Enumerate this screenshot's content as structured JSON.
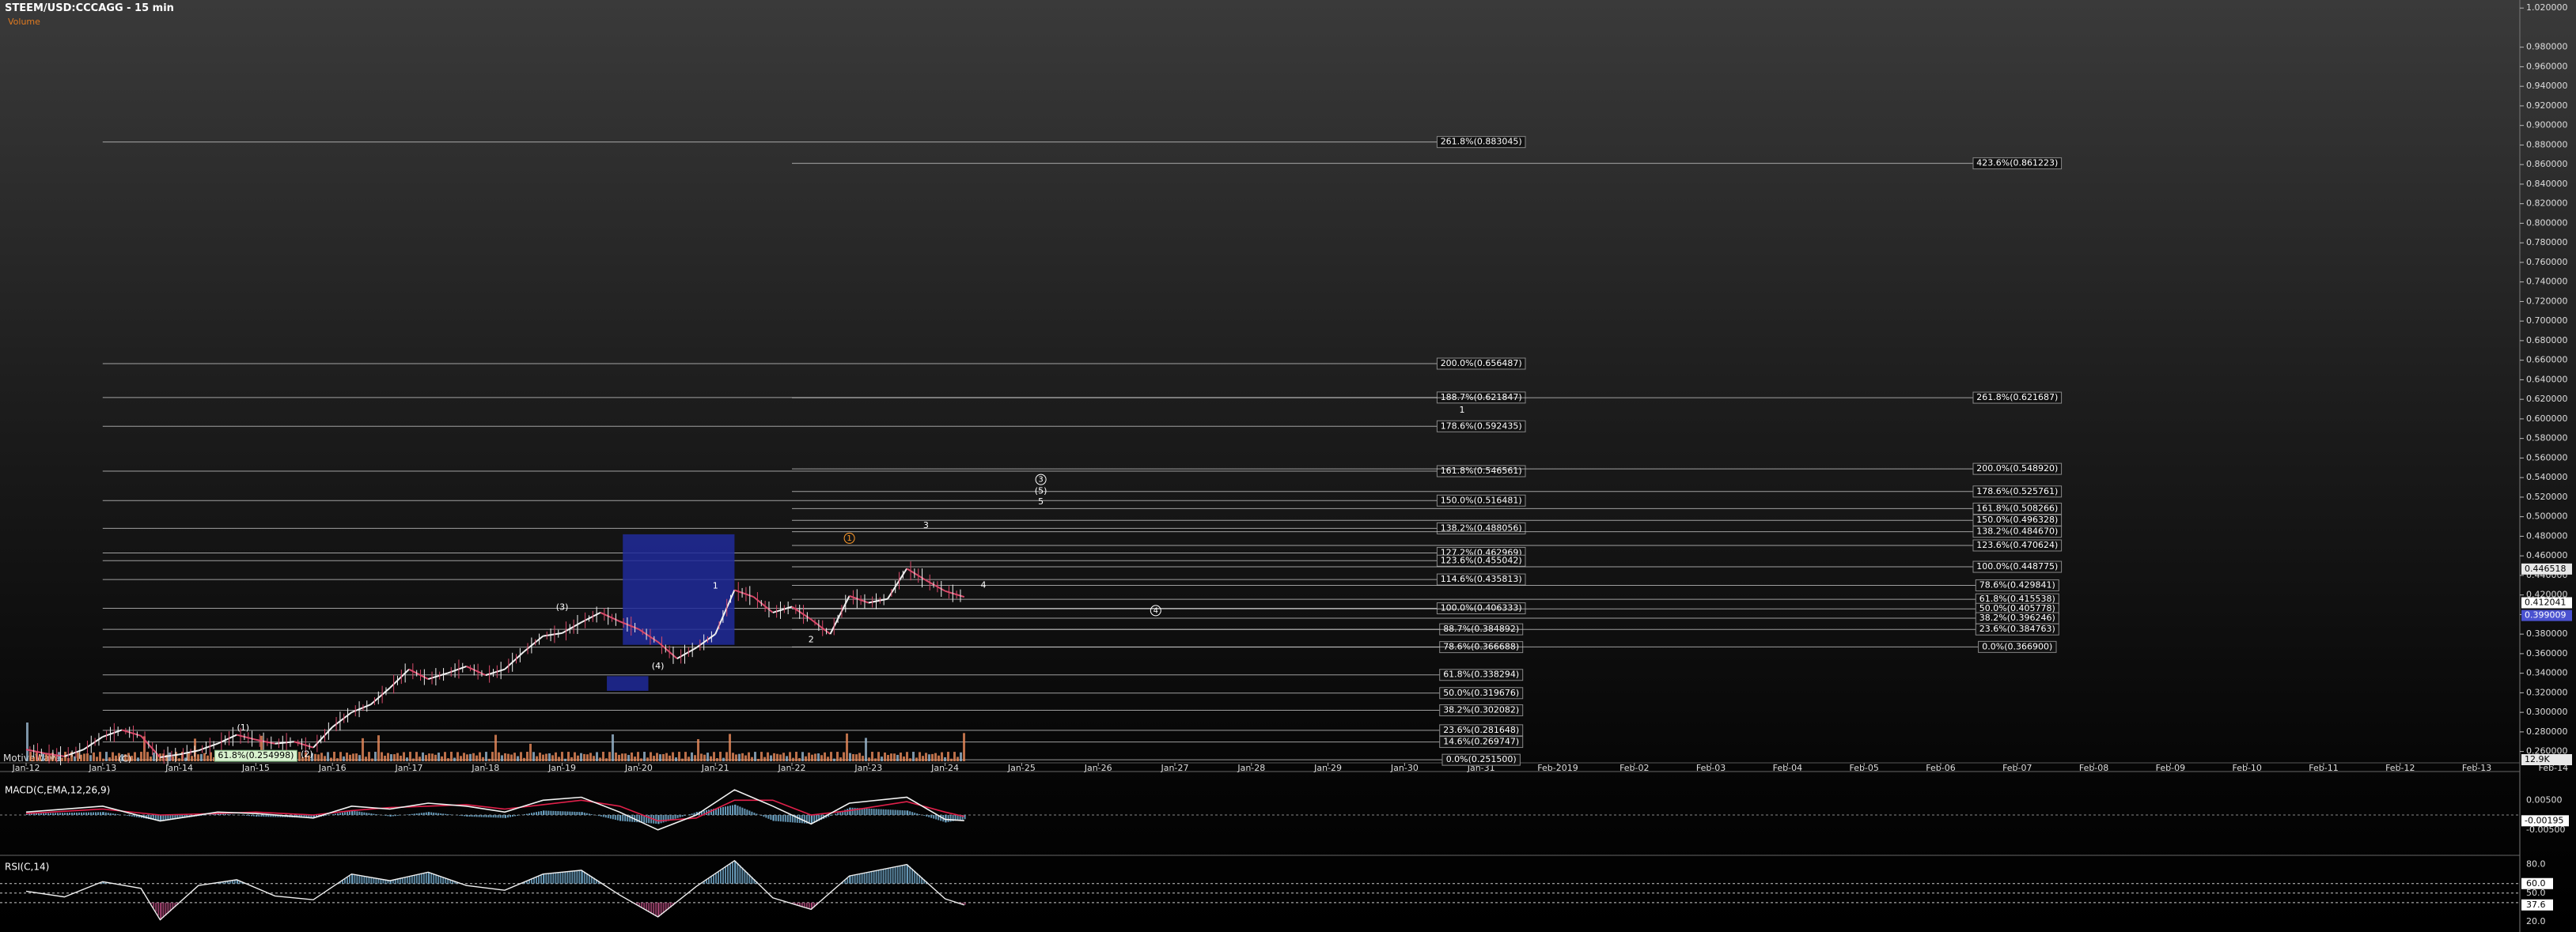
{
  "header": {
    "title": "STEEM/USD:CCCAGG - 15 min",
    "volume_label": "Volume",
    "brand": "MotiveWave"
  },
  "colors": {
    "up": "#f0f0f0",
    "down": "#d84a6a",
    "box": "#202a9a",
    "volume": "#e88a5a",
    "macd": "#f2f2f2",
    "signal": "#e0204a",
    "hist": "#6fa6c8",
    "rsi": "#f0f0f0"
  },
  "chart_data": {
    "type": "line",
    "x_ticks": [
      "Jan-12",
      "Jan-13",
      "Jan-14",
      "Jan-15",
      "Jan-16",
      "Jan-17",
      "Jan-18",
      "Jan-19",
      "Jan-20",
      "Jan-21",
      "Jan-22",
      "Jan-23",
      "Jan-24",
      "Jan-25",
      "Jan-26",
      "Jan-27",
      "Jan-28",
      "Jan-29",
      "Jan-30",
      "Jan-31",
      "Feb-2019",
      "Feb-02",
      "Feb-03",
      "Feb-04",
      "Feb-05",
      "Feb-06",
      "Feb-07",
      "Feb-08",
      "Feb-09",
      "Feb-10",
      "Feb-11",
      "Feb-12",
      "Feb-13",
      "Feb-14"
    ],
    "y_ticks": [
      "1.020000",
      "0.980000",
      "0.960000",
      "0.940000",
      "0.920000",
      "0.900000",
      "0.880000",
      "0.860000",
      "0.840000",
      "0.820000",
      "0.800000",
      "0.780000",
      "0.760000",
      "0.740000",
      "0.720000",
      "0.700000",
      "0.680000",
      "0.660000",
      "0.640000",
      "0.620000",
      "0.600000",
      "0.580000",
      "0.560000",
      "0.540000",
      "0.520000",
      "0.500000",
      "0.480000",
      "0.460000",
      "0.440000",
      "0.420000",
      "0.400000",
      "0.380000",
      "0.360000",
      "0.340000",
      "0.320000",
      "0.300000",
      "0.280000",
      "0.260000"
    ],
    "ylim": [
      0.25,
      1.025
    ],
    "price_labels": {
      "top": "0.446518",
      "mid": "0.412041",
      "bot": "0.399009",
      "volume": "12.9K"
    },
    "price_path": [
      [
        "Jan-12 00:00",
        0.262
      ],
      [
        "Jan-12 06:00",
        0.258
      ],
      [
        "Jan-12 12:00",
        0.255
      ],
      [
        "Jan-12 18:00",
        0.262
      ],
      [
        "Jan-13 00:00",
        0.275
      ],
      [
        "Jan-13 06:00",
        0.282
      ],
      [
        "Jan-13 12:00",
        0.276
      ],
      [
        "Jan-13 18:00",
        0.254
      ],
      [
        "Jan-14 00:00",
        0.257
      ],
      [
        "Jan-14 06:00",
        0.261
      ],
      [
        "Jan-14 12:00",
        0.268
      ],
      [
        "Jan-14 18:00",
        0.277
      ],
      [
        "Jan-15 00:00",
        0.272
      ],
      [
        "Jan-15 06:00",
        0.268
      ],
      [
        "Jan-15 12:00",
        0.27
      ],
      [
        "Jan-15 18:00",
        0.264
      ],
      [
        "Jan-16 00:00",
        0.285
      ],
      [
        "Jan-16 06:00",
        0.3
      ],
      [
        "Jan-16 12:00",
        0.308
      ],
      [
        "Jan-16 18:00",
        0.325
      ],
      [
        "Jan-17 00:00",
        0.344
      ],
      [
        "Jan-17 06:00",
        0.334
      ],
      [
        "Jan-17 12:00",
        0.34
      ],
      [
        "Jan-17 18:00",
        0.347
      ],
      [
        "Jan-18 00:00",
        0.338
      ],
      [
        "Jan-18 06:00",
        0.344
      ],
      [
        "Jan-18 12:00",
        0.362
      ],
      [
        "Jan-18 18:00",
        0.378
      ],
      [
        "Jan-19 00:00",
        0.381
      ],
      [
        "Jan-19 06:00",
        0.392
      ],
      [
        "Jan-19 12:00",
        0.402
      ],
      [
        "Jan-19 18:00",
        0.393
      ],
      [
        "Jan-20 00:00",
        0.385
      ],
      [
        "Jan-20 06:00",
        0.372
      ],
      [
        "Jan-20 12:00",
        0.355
      ],
      [
        "Jan-20 18:00",
        0.366
      ],
      [
        "Jan-21 00:00",
        0.38
      ],
      [
        "Jan-21 06:00",
        0.425
      ],
      [
        "Jan-21 12:00",
        0.418
      ],
      [
        "Jan-21 18:00",
        0.402
      ],
      [
        "Jan-22 00:00",
        0.408
      ],
      [
        "Jan-22 06:00",
        0.395
      ],
      [
        "Jan-22 12:00",
        0.38
      ],
      [
        "Jan-22 18:00",
        0.419
      ],
      [
        "Jan-23 00:00",
        0.412
      ],
      [
        "Jan-23 06:00",
        0.416
      ],
      [
        "Jan-23 12:00",
        0.447
      ],
      [
        "Jan-23 18:00",
        0.435
      ],
      [
        "Jan-24 00:00",
        0.424
      ],
      [
        "Jan-24 06:00",
        0.418
      ]
    ],
    "fib_levels": [
      {
        "label": "261.8%(0.883045)",
        "value": 0.883045,
        "from": "Jan-13 00:00",
        "to": "Jan-31 00:00"
      },
      {
        "label": "200.0%(0.656487)",
        "value": 0.656487,
        "from": "Jan-13 00:00",
        "to": "Jan-31 00:00"
      },
      {
        "label": "188.7%(0.621847)",
        "value": 0.621847,
        "from": "Jan-13 00:00",
        "to": "Jan-31 00:00"
      },
      {
        "label": "178.6%(0.592435)",
        "value": 0.592435,
        "from": "Jan-13 00:00",
        "to": "Jan-31 00:00"
      },
      {
        "label": "161.8%(0.546561)",
        "value": 0.546561,
        "from": "Jan-13 00:00",
        "to": "Jan-31 00:00"
      },
      {
        "label": "150.0%(0.516481)",
        "value": 0.516481,
        "from": "Jan-13 00:00",
        "to": "Jan-31 00:00"
      },
      {
        "label": "138.2%(0.488056)",
        "value": 0.488056,
        "from": "Jan-13 00:00",
        "to": "Jan-31 00:00"
      },
      {
        "label": "127.2%(0.462969)",
        "value": 0.462969,
        "from": "Jan-13 00:00",
        "to": "Jan-31 00:00"
      },
      {
        "label": "123.6%(0.455042)",
        "value": 0.455042,
        "from": "Jan-13 00:00",
        "to": "Jan-31 00:00"
      },
      {
        "label": "114.6%(0.435813)",
        "value": 0.435813,
        "from": "Jan-13 00:00",
        "to": "Jan-31 00:00"
      },
      {
        "label": "100.0%(0.406333)",
        "value": 0.406333,
        "from": "Jan-13 00:00",
        "to": "Jan-31 00:00"
      },
      {
        "label": "88.7%(0.384892)",
        "value": 0.384892,
        "from": "Jan-13 00:00",
        "to": "Jan-31 00:00"
      },
      {
        "label": "78.6%(0.366688)",
        "value": 0.366688,
        "from": "Jan-13 00:00",
        "to": "Jan-31 00:00"
      },
      {
        "label": "61.8%(0.338294)",
        "value": 0.338294,
        "from": "Jan-13 00:00",
        "to": "Jan-31 00:00"
      },
      {
        "label": "50.0%(0.319676)",
        "value": 0.319676,
        "from": "Jan-13 00:00",
        "to": "Jan-31 00:00"
      },
      {
        "label": "38.2%(0.302082)",
        "value": 0.302082,
        "from": "Jan-13 00:00",
        "to": "Jan-31 00:00"
      },
      {
        "label": "23.6%(0.281648)",
        "value": 0.281648,
        "from": "Jan-13 00:00",
        "to": "Jan-31 00:00"
      },
      {
        "label": "14.6%(0.269747)",
        "value": 0.269747,
        "from": "Jan-13 00:00",
        "to": "Jan-31 00:00"
      },
      {
        "label": "0.0%(0.251500)",
        "value": 0.2515,
        "from": "Jan-13 00:00",
        "to": "Jan-31 00:00"
      },
      {
        "label": "423.6%(0.861223)",
        "value": 0.861223,
        "from": "Jan-22 00:00",
        "to": "Feb-07 00:00"
      },
      {
        "label": "261.8%(0.621687)",
        "value": 0.621687,
        "from": "Jan-22 00:00",
        "to": "Feb-07 00:00"
      },
      {
        "label": "200.0%(0.548920)",
        "value": 0.54892,
        "from": "Jan-22 00:00",
        "to": "Feb-07 00:00"
      },
      {
        "label": "178.6%(0.525761)",
        "value": 0.525761,
        "from": "Jan-22 00:00",
        "to": "Feb-07 00:00"
      },
      {
        "label": "161.8%(0.508266)",
        "value": 0.508266,
        "from": "Jan-22 00:00",
        "to": "Feb-07 00:00"
      },
      {
        "label": "150.0%(0.496328)",
        "value": 0.496328,
        "from": "Jan-22 00:00",
        "to": "Feb-07 00:00"
      },
      {
        "label": "138.2%(0.484670)",
        "value": 0.48467,
        "from": "Jan-22 00:00",
        "to": "Feb-07 00:00"
      },
      {
        "label": "123.6%(0.470624)",
        "value": 0.470624,
        "from": "Jan-22 00:00",
        "to": "Feb-07 00:00"
      },
      {
        "label": "100.0%(0.448775)",
        "value": 0.448775,
        "from": "Jan-22 00:00",
        "to": "Feb-07 00:00"
      },
      {
        "label": "78.6%(0.429841)",
        "value": 0.429841,
        "from": "Jan-22 00:00",
        "to": "Feb-07 00:00"
      },
      {
        "label": "61.8%(0.415538)",
        "value": 0.415538,
        "from": "Jan-22 00:00",
        "to": "Feb-07 00:00"
      },
      {
        "label": "50.0%(0.405778)",
        "value": 0.405778,
        "from": "Jan-22 00:00",
        "to": "Feb-07 00:00"
      },
      {
        "label": "38.2%(0.396246)",
        "value": 0.396246,
        "from": "Jan-22 00:00",
        "to": "Feb-07 00:00"
      },
      {
        "label": "23.6%(0.384763)",
        "value": 0.384763,
        "from": "Jan-22 00:00",
        "to": "Feb-07 00:00"
      },
      {
        "label": "0.0%(0.366900)",
        "value": 0.3669,
        "from": "Jan-22 00:00",
        "to": "Feb-07 00:00"
      }
    ],
    "bottom_fib_label": "61.8%(0.254998)",
    "boxes": [
      {
        "from": "Jan-19 19:00",
        "to": "Jan-21 06:00",
        "top": 0.482,
        "bottom": 0.369
      },
      {
        "from": "Jan-19 14:00",
        "to": "Jan-20 03:00",
        "top": 0.337,
        "bottom": 0.322
      }
    ],
    "wave_labels": [
      {
        "text": "(1)",
        "t": "Jan-14 20:00",
        "p": 0.284,
        "color": "#ffffff",
        "circle": false
      },
      {
        "text": "(2)",
        "t": "Jan-15 16:00",
        "p": 0.257,
        "color": "#ffffff",
        "circle": false
      },
      {
        "text": "(3)",
        "t": "Jan-19 00:00",
        "p": 0.407,
        "color": "#ffffff",
        "circle": false
      },
      {
        "text": "(4)",
        "t": "Jan-20 06:00",
        "p": 0.347,
        "color": "#ffffff",
        "circle": false
      },
      {
        "text": "1",
        "t": "Jan-21 00:00",
        "p": 0.429,
        "color": "#ffffff",
        "circle": false
      },
      {
        "text": "2",
        "t": "Jan-22 06:00",
        "p": 0.374,
        "color": "#ffffff",
        "circle": false
      },
      {
        "text": "3",
        "t": "Jan-23 18:00",
        "p": 0.491,
        "color": "#ffffff",
        "circle": false
      },
      {
        "text": "4",
        "t": "Jan-24 12:00",
        "p": 0.43,
        "color": "#ffffff",
        "circle": false
      },
      {
        "text": "5",
        "t": "Jan-25 06:00",
        "p": 0.515,
        "color": "#ffffff",
        "circle": false
      },
      {
        "text": "(5)",
        "t": "Jan-25 06:00",
        "p": 0.526,
        "color": "#ffffff",
        "circle": false
      },
      {
        "text": "3",
        "t": "Jan-25 06:00",
        "p": 0.538,
        "color": "#ffffff",
        "circle": true
      },
      {
        "text": "4",
        "t": "Jan-26 18:00",
        "p": 0.404,
        "color": "#ffffff",
        "circle": true
      },
      {
        "text": "1",
        "t": "Jan-30 18:00",
        "p": 0.609,
        "color": "#ffffff",
        "circle": false
      },
      {
        "text": "1",
        "t": "Jan-22 18:00",
        "p": 0.478,
        "color": "#ff9a2a",
        "circle": true
      },
      {
        "text": "(C)",
        "t": "Jan-13 07:00",
        "p": 0.252,
        "color": "#ffffff",
        "circle": false
      }
    ],
    "macd": {
      "title": "MACD(C,EMA,12,26,9)",
      "ticks": [
        "0.00500",
        "-0.00500"
      ],
      "value_label": "-0.00195",
      "ylim": [
        -0.012,
        0.012
      ],
      "macd_path": [
        [
          "Jan-12 00:00",
          0.001
        ],
        [
          "Jan-13 00:00",
          0.003
        ],
        [
          "Jan-13 18:00",
          -0.002
        ],
        [
          "Jan-14 12:00",
          0.001
        ],
        [
          "Jan-15 00:00",
          0.0005
        ],
        [
          "Jan-15 18:00",
          -0.001
        ],
        [
          "Jan-16 06:00",
          0.003
        ],
        [
          "Jan-16 18:00",
          0.002
        ],
        [
          "Jan-17 06:00",
          0.004
        ],
        [
          "Jan-17 18:00",
          0.003
        ],
        [
          "Jan-18 06:00",
          0.001
        ],
        [
          "Jan-18 18:00",
          0.005
        ],
        [
          "Jan-19 06:00",
          0.006
        ],
        [
          "Jan-19 18:00",
          0.001
        ],
        [
          "Jan-20 06:00",
          -0.005
        ],
        [
          "Jan-20 18:00",
          0.0
        ],
        [
          "Jan-21 06:00",
          0.0085
        ],
        [
          "Jan-21 18:00",
          0.003
        ],
        [
          "Jan-22 06:00",
          -0.003
        ],
        [
          "Jan-22 18:00",
          0.004
        ],
        [
          "Jan-23 12:00",
          0.006
        ],
        [
          "Jan-24 00:00",
          -0.0015
        ],
        [
          "Jan-24 06:00",
          -0.0019
        ]
      ],
      "signal_path": [
        [
          "Jan-12 00:00",
          0.0005
        ],
        [
          "Jan-13 00:00",
          0.002
        ],
        [
          "Jan-13 18:00",
          0.0
        ],
        [
          "Jan-14 12:00",
          0.0005
        ],
        [
          "Jan-15 00:00",
          0.001
        ],
        [
          "Jan-15 18:00",
          0.0
        ],
        [
          "Jan-16 06:00",
          0.0015
        ],
        [
          "Jan-16 18:00",
          0.0025
        ],
        [
          "Jan-17 06:00",
          0.003
        ],
        [
          "Jan-17 18:00",
          0.0035
        ],
        [
          "Jan-18 06:00",
          0.002
        ],
        [
          "Jan-18 18:00",
          0.0035
        ],
        [
          "Jan-19 06:00",
          0.005
        ],
        [
          "Jan-19 18:00",
          0.003
        ],
        [
          "Jan-20 06:00",
          -0.002
        ],
        [
          "Jan-20 18:00",
          -0.001
        ],
        [
          "Jan-21 06:00",
          0.005
        ],
        [
          "Jan-21 18:00",
          0.005
        ],
        [
          "Jan-22 06:00",
          0.0
        ],
        [
          "Jan-22 18:00",
          0.0015
        ],
        [
          "Jan-23 12:00",
          0.0045
        ],
        [
          "Jan-24 00:00",
          0.001
        ],
        [
          "Jan-24 06:00",
          -0.0005
        ]
      ]
    },
    "rsi": {
      "title": "RSI(C,14)",
      "ticks": [
        "80.0",
        "60.0",
        "50.0",
        "37.6",
        "20.0"
      ],
      "ylim": [
        15,
        88
      ],
      "levels": [
        60,
        50,
        40
      ],
      "rsi_path": [
        [
          "Jan-12 00:00",
          52
        ],
        [
          "Jan-12 12:00",
          46
        ],
        [
          "Jan-13 00:00",
          62
        ],
        [
          "Jan-13 12:00",
          55
        ],
        [
          "Jan-13 18:00",
          22
        ],
        [
          "Jan-14 06:00",
          58
        ],
        [
          "Jan-14 18:00",
          64
        ],
        [
          "Jan-15 06:00",
          47
        ],
        [
          "Jan-15 18:00",
          43
        ],
        [
          "Jan-16 06:00",
          70
        ],
        [
          "Jan-16 18:00",
          63
        ],
        [
          "Jan-17 06:00",
          72
        ],
        [
          "Jan-17 18:00",
          58
        ],
        [
          "Jan-18 06:00",
          53
        ],
        [
          "Jan-18 18:00",
          70
        ],
        [
          "Jan-19 06:00",
          74
        ],
        [
          "Jan-19 18:00",
          48
        ],
        [
          "Jan-20 06:00",
          25
        ],
        [
          "Jan-20 18:00",
          57
        ],
        [
          "Jan-21 06:00",
          84
        ],
        [
          "Jan-21 18:00",
          45
        ],
        [
          "Jan-22 06:00",
          33
        ],
        [
          "Jan-22 18:00",
          68
        ],
        [
          "Jan-23 12:00",
          80
        ],
        [
          "Jan-24 00:00",
          44
        ],
        [
          "Jan-24 06:00",
          37.6
        ]
      ]
    }
  }
}
